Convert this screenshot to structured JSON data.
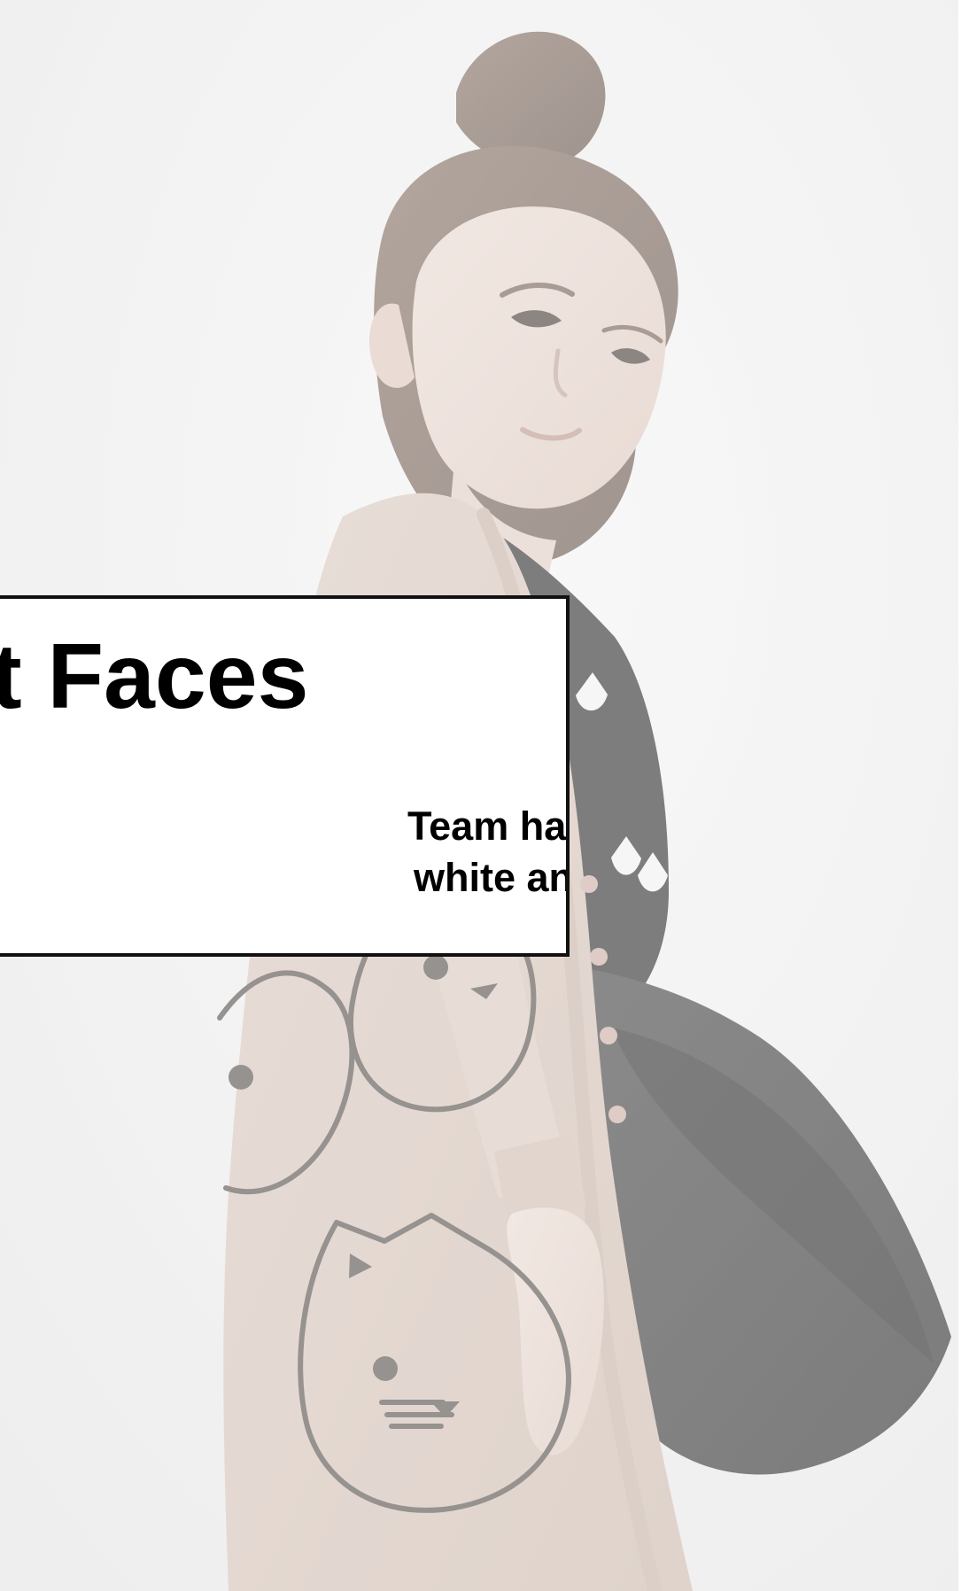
{
  "caption": {
    "title": "t Faces",
    "body_lines": [
      "Team have been tracking",
      "white and cat trend."
    ]
  },
  "colors": {
    "background": "#e9e9e9",
    "card_background": "#ffffff",
    "card_border": "#111111",
    "text": "#000000"
  }
}
